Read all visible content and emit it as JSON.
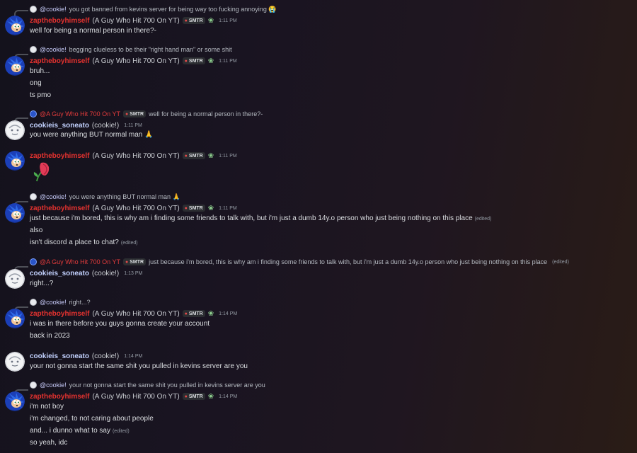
{
  "colors": {
    "username_zap": "#e5322f",
    "username_cookie": "#c3d2ff",
    "mention": "#e23b3b"
  },
  "users": {
    "zap": {
      "name": "zaptheboyhimself",
      "display": "(A Guy Who Hit 700 On YT)",
      "tag": "SMTR",
      "avatar_icon": "blue-hedgehog-avatar"
    },
    "cookie": {
      "name": "cookieis_soneato",
      "display": "(cookie!)",
      "avatar_icon": "white-face-avatar"
    }
  },
  "mentions": {
    "cookie": "@cookie!",
    "zap": "@A Guy Who Hit 700 On YT"
  },
  "edited_label": "(edited)",
  "messages": [
    {
      "reply": "you got banned from kevins server for being way too fucking annoying 😭",
      "time": "1:11 PM",
      "lines": [
        "well for being a normal person in there?-"
      ]
    },
    {
      "reply": "begging clueless to be their \"right hand man\" or some shit",
      "time": "1:11 PM",
      "lines": [
        "bruh...",
        "ong",
        "ts pmo"
      ]
    },
    {
      "reply": "well for being a normal person in there?-",
      "time": "1:11 PM",
      "lines": [
        "you were anything BUT normal man 🙏"
      ]
    },
    {
      "time": "1:11 PM",
      "emoji_icon": "wilted-flower-icon"
    },
    {
      "reply": "you were anything BUT normal man 🙏",
      "time": "1:11 PM",
      "lines": [
        "just because i'm bored, this is why am i finding some friends to talk with, but i'm just a dumb 14y.o person who just being nothing on this place",
        "also",
        "isn't discord a place to chat?"
      ]
    },
    {
      "reply": "just because i'm bored, this is why am i finding some friends to talk with, but i'm just a dumb 14y.o person who just being nothing on this place",
      "time": "1:13 PM",
      "lines": [
        "right...?"
      ]
    },
    {
      "reply": "right...?",
      "time": "1:14 PM",
      "lines": [
        "i was in there before you guys gonna create your account",
        "back in 2023"
      ]
    },
    {
      "time": "1:14 PM",
      "lines": [
        "your not gonna start the same shit you pulled in kevins server are you"
      ]
    },
    {
      "reply": "your not gonna start the same shit you pulled in kevins server are you",
      "time": "1:14 PM",
      "lines": [
        "i'm not boy",
        "i'm changed, to not caring about people",
        "and... i dunno what to say",
        "so yeah, idc"
      ]
    }
  ]
}
